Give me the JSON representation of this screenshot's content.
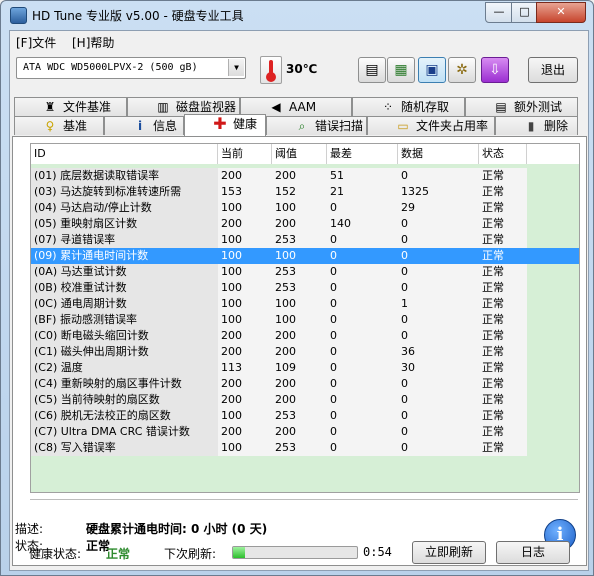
{
  "window": {
    "title": "HD Tune 专业版 v5.00 - 硬盘专业工具",
    "min": "—",
    "max": "□",
    "close": "✕"
  },
  "menu": {
    "file": "[F]文件",
    "help": "[H]帮助"
  },
  "toolbar": {
    "drive": "ATA    WDC WD5000LPVX-2 (500 gB)",
    "temperature": "30℃",
    "exit_label": "退出",
    "buttons": [
      {
        "icon": "copy-text-icon",
        "glyph": "▤"
      },
      {
        "icon": "copy-screenshot-icon",
        "glyph": "▦"
      },
      {
        "icon": "save-icon",
        "glyph": "▣"
      },
      {
        "icon": "options-icon",
        "glyph": "✲"
      },
      {
        "icon": "download-icon",
        "glyph": "⇩"
      }
    ]
  },
  "tabs": {
    "row1": [
      {
        "label": "文件基准",
        "icon": "benchmark-file-icon",
        "glyph": "♜"
      },
      {
        "label": "磁盘监视器",
        "icon": "disk-monitor-icon",
        "glyph": "▥"
      },
      {
        "label": "AAM",
        "icon": "speaker-icon",
        "glyph": "◀"
      },
      {
        "label": "随机存取",
        "icon": "random-access-icon",
        "glyph": "⁘"
      },
      {
        "label": "额外测试",
        "icon": "extra-tests-icon",
        "glyph": "▤"
      }
    ],
    "row2": [
      {
        "label": "基准",
        "icon": "lightbulb-icon",
        "glyph": "♀"
      },
      {
        "label": "信息",
        "icon": "info-icon",
        "glyph": "i"
      },
      {
        "label": "健康",
        "icon": "health-cross-icon",
        "glyph": "✚"
      },
      {
        "label": "错误扫描",
        "icon": "error-scan-icon",
        "glyph": "⌕"
      },
      {
        "label": "文件夹占用率",
        "icon": "folder-icon",
        "glyph": "▭"
      },
      {
        "label": "删除",
        "icon": "trash-icon",
        "glyph": "▮"
      }
    ],
    "active": "健康"
  },
  "table": {
    "headers": {
      "id": "ID",
      "current": "当前",
      "threshold": "阈值",
      "worst": "最差",
      "data": "数据",
      "status": "状态"
    },
    "rows": [
      {
        "id": "(01) 底层数据读取错误率",
        "current": "200",
        "threshold": "200",
        "worst": "51",
        "data": "0",
        "status": "正常"
      },
      {
        "id": "(03) 马达旋转到标准转速所需",
        "current": "153",
        "threshold": "152",
        "worst": "21",
        "data": "1325",
        "status": "正常"
      },
      {
        "id": "(04) 马达启动/停止计数",
        "current": "100",
        "threshold": "100",
        "worst": "0",
        "data": "29",
        "status": "正常"
      },
      {
        "id": "(05) 重映射扇区计数",
        "current": "200",
        "threshold": "200",
        "worst": "140",
        "data": "0",
        "status": "正常"
      },
      {
        "id": "(07) 寻道错误率",
        "current": "100",
        "threshold": "253",
        "worst": "0",
        "data": "0",
        "status": "正常"
      },
      {
        "id": "(09) 累计通电时间计数",
        "current": "100",
        "threshold": "100",
        "worst": "0",
        "data": "0",
        "status": "正常"
      },
      {
        "id": "(0A) 马达重试计数",
        "current": "100",
        "threshold": "253",
        "worst": "0",
        "data": "0",
        "status": "正常"
      },
      {
        "id": "(0B) 校准重试计数",
        "current": "100",
        "threshold": "253",
        "worst": "0",
        "data": "0",
        "status": "正常"
      },
      {
        "id": "(0C) 通电周期计数",
        "current": "100",
        "threshold": "100",
        "worst": "0",
        "data": "1",
        "status": "正常"
      },
      {
        "id": "(BF) 振动感测错误率",
        "current": "100",
        "threshold": "100",
        "worst": "0",
        "data": "0",
        "status": "正常"
      },
      {
        "id": "(C0) 断电磁头缩回计数",
        "current": "200",
        "threshold": "200",
        "worst": "0",
        "data": "0",
        "status": "正常"
      },
      {
        "id": "(C1) 磁头伸出周期计数",
        "current": "200",
        "threshold": "200",
        "worst": "0",
        "data": "36",
        "status": "正常"
      },
      {
        "id": "(C2) 温度",
        "current": "113",
        "threshold": "109",
        "worst": "0",
        "data": "30",
        "status": "正常"
      },
      {
        "id": "(C4) 重新映射的扇区事件计数",
        "current": "200",
        "threshold": "200",
        "worst": "0",
        "data": "0",
        "status": "正常"
      },
      {
        "id": "(C5) 当前待映射的扇区数",
        "current": "200",
        "threshold": "200",
        "worst": "0",
        "data": "0",
        "status": "正常"
      },
      {
        "id": "(C6) 脱机无法校正的扇区数",
        "current": "100",
        "threshold": "253",
        "worst": "0",
        "data": "0",
        "status": "正常"
      },
      {
        "id": "(C7) Ultra DMA CRC 错误计数",
        "current": "200",
        "threshold": "200",
        "worst": "0",
        "data": "0",
        "status": "正常"
      },
      {
        "id": "(C8) 写入错误率",
        "current": "100",
        "threshold": "253",
        "worst": "0",
        "data": "0",
        "status": "正常"
      }
    ],
    "selected_index": 5
  },
  "details": {
    "desc_label": "描述:",
    "desc_value": "硬盘累计通电时间: 0 小时 (0 天)",
    "status_label": "状态:",
    "status_value": "正常"
  },
  "footer": {
    "health_label": "健康状态:",
    "health_value": "正常",
    "next_refresh_label": "下次刷新:",
    "refresh_progress": 0.1,
    "countdown": "0:54",
    "refresh_button": "立即刷新",
    "log_button": "日志"
  }
}
